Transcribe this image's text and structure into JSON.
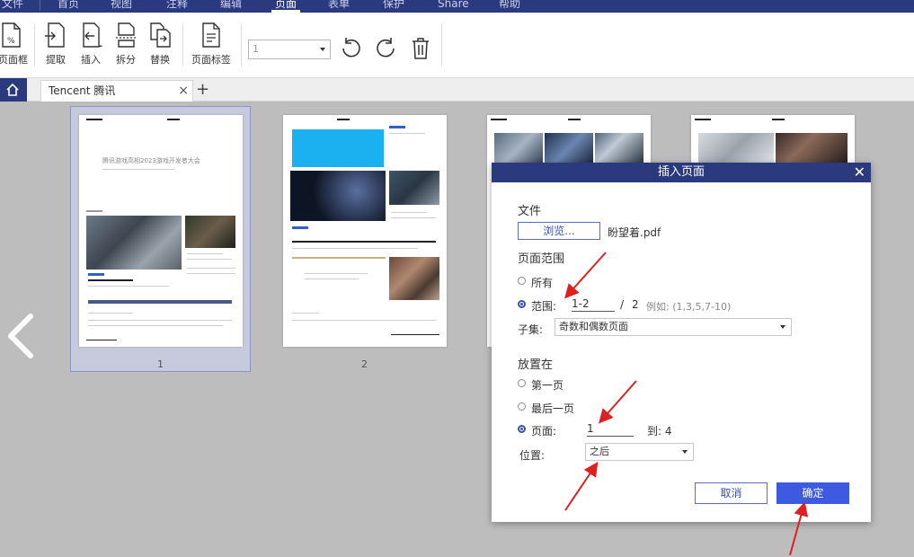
{
  "menu": {
    "items": [
      "文件",
      "首页",
      "视图",
      "注释",
      "编辑",
      "页面",
      "表单",
      "保护",
      "Share",
      "帮助"
    ],
    "active": "页面"
  },
  "toolbar": {
    "page_box_label": "页面框",
    "extract_label": "提取",
    "insert_label": "插入",
    "split_label": "拆分",
    "replace_label": "替换",
    "page_label_label": "页面标签",
    "page_select_value": "1"
  },
  "tabs": {
    "doc_title": "Tencent 腾讯",
    "close_glyph": "×",
    "add_glyph": "+"
  },
  "thumbnails": {
    "page1_number": "1",
    "page2_number": "2",
    "page1_heading": "腾讯游戏高相2023游戏开发者大会"
  },
  "dialog": {
    "title": "插入页面",
    "close_glyph": "✕",
    "file_section": "文件",
    "browse_label": "浏览...",
    "file_name": "盼望着.pdf",
    "range_section": "页面范围",
    "range_all": "所有",
    "range_custom": "范围:",
    "range_value": "1-2",
    "range_sep": "/",
    "range_total": "2",
    "range_example": "例如:   (1,3,5,7-10)",
    "subset_label": "子集:",
    "subset_value": "奇数和偶数页面",
    "place_section": "放置在",
    "place_first": "第一页",
    "place_last": "最后一页",
    "place_page": "页面:",
    "place_page_value": "1",
    "place_to": "到: 4",
    "position_label": "位置:",
    "position_value": "之后",
    "cancel_label": "取消",
    "ok_label": "确定"
  },
  "colors": {
    "brand": "#2b3a7e",
    "primary_button": "#3d5be0",
    "annotation_arrow": "#e02020"
  }
}
